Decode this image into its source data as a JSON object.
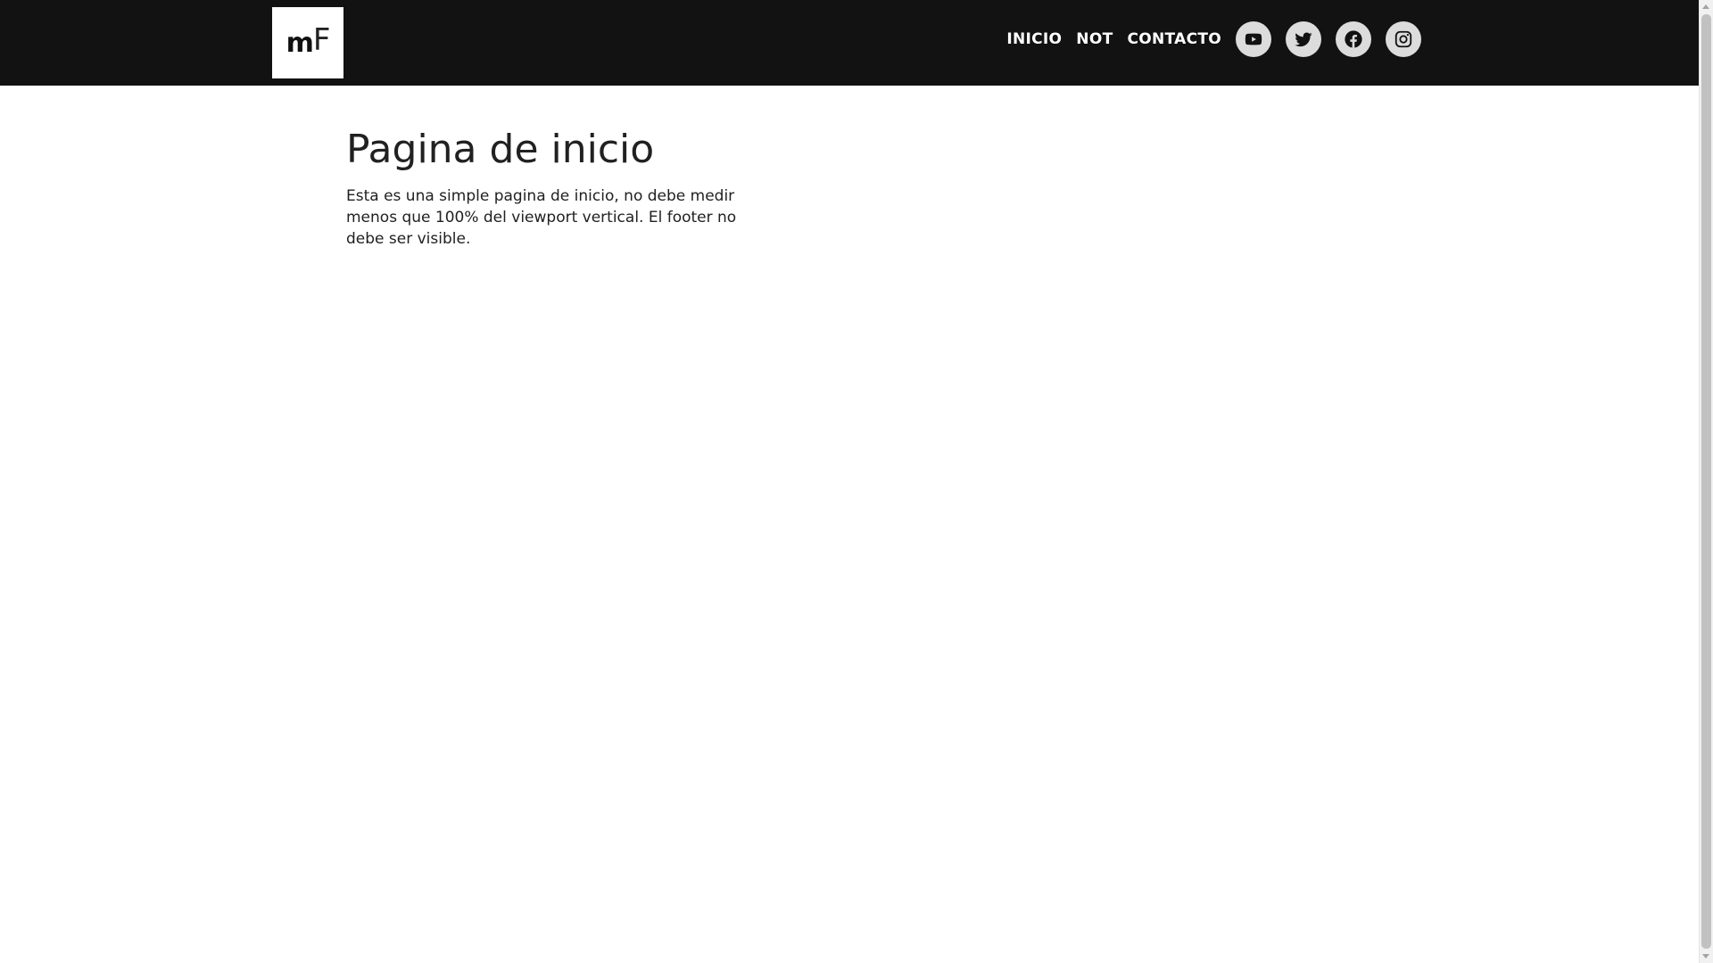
{
  "navbar": {
    "logo": {
      "name": "mF logo",
      "text_m": "m",
      "text_f": "F"
    },
    "links": [
      {
        "label": "INICIO"
      },
      {
        "label": "NOT"
      },
      {
        "label": "CONTACTO"
      }
    ],
    "social": [
      {
        "icon": "youtube-icon"
      },
      {
        "icon": "twitter-icon"
      },
      {
        "icon": "facebook-icon"
      },
      {
        "icon": "instagram-icon"
      }
    ]
  },
  "main": {
    "title": "Pagina de inicio",
    "description": "Esta es una simple pagina de inicio, no debe medir menos que 100% del viewport vertical. El footer no debe ser visible."
  },
  "colors": {
    "navbar_bg": "#121212",
    "social_bg": "#dcdcdc",
    "text": "#212121"
  }
}
